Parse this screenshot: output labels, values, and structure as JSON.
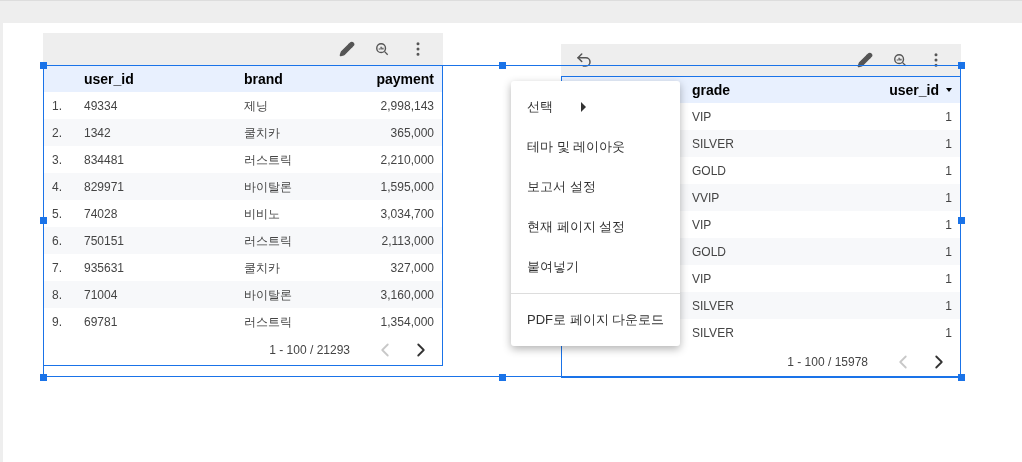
{
  "charts": [
    {
      "undo": false,
      "columns": [
        {
          "label": "user_id",
          "kind": "text",
          "sorted": false
        },
        {
          "label": "brand",
          "kind": "text",
          "sorted": false
        },
        {
          "label": "payment",
          "kind": "number",
          "sorted": false
        }
      ],
      "rows": [
        {
          "index": "1.",
          "cells": [
            "49334",
            "제닝",
            "2,998,143"
          ]
        },
        {
          "index": "2.",
          "cells": [
            "1342",
            "쿨치카",
            "365,000"
          ]
        },
        {
          "index": "3.",
          "cells": [
            "834481",
            "러스트릭",
            "2,210,000"
          ]
        },
        {
          "index": "4.",
          "cells": [
            "829971",
            "바이탈론",
            "1,595,000"
          ]
        },
        {
          "index": "5.",
          "cells": [
            "74028",
            "비비노",
            "3,034,700"
          ]
        },
        {
          "index": "6.",
          "cells": [
            "750151",
            "러스트릭",
            "2,113,000"
          ]
        },
        {
          "index": "7.",
          "cells": [
            "935631",
            "쿨치카",
            "327,000"
          ]
        },
        {
          "index": "8.",
          "cells": [
            "71004",
            "바이탈론",
            "3,160,000"
          ]
        },
        {
          "index": "9.",
          "cells": [
            "69781",
            "러스트릭",
            "1,354,000"
          ]
        }
      ],
      "pagination": {
        "text": "1 - 100 / 21293",
        "prev_disabled": true,
        "next_disabled": false
      }
    },
    {
      "undo": true,
      "columns": [
        {
          "label": "grade",
          "kind": "text",
          "sorted": false
        },
        {
          "label": "user_id",
          "kind": "number",
          "sorted": true
        }
      ],
      "rows": [
        {
          "cells": [
            "VIP",
            "1"
          ]
        },
        {
          "cells": [
            "SILVER",
            "1"
          ]
        },
        {
          "cells": [
            "GOLD",
            "1"
          ]
        },
        {
          "cells": [
            "VVIP",
            "1"
          ]
        },
        {
          "cells": [
            "VIP",
            "1"
          ]
        },
        {
          "cells": [
            "GOLD",
            "1"
          ]
        },
        {
          "cells": [
            "VIP",
            "1"
          ]
        },
        {
          "cells": [
            "SILVER",
            "1"
          ]
        },
        {
          "cells": [
            "SILVER",
            "1"
          ]
        }
      ],
      "pagination": {
        "text": "1 - 100 / 15978",
        "prev_disabled": true,
        "next_disabled": false
      }
    }
  ],
  "menu": {
    "groups": [
      [
        {
          "label": "선택",
          "kind": "submenu"
        },
        {
          "label": "테마 및 레이아웃",
          "kind": "item"
        },
        {
          "label": "보고서 설정",
          "kind": "item"
        },
        {
          "label": "현재 페이지 설정",
          "kind": "item"
        },
        {
          "label": "붙여넣기",
          "kind": "item"
        }
      ],
      [
        {
          "label": "PDF로 페이지 다운로드",
          "kind": "item"
        }
      ]
    ]
  }
}
